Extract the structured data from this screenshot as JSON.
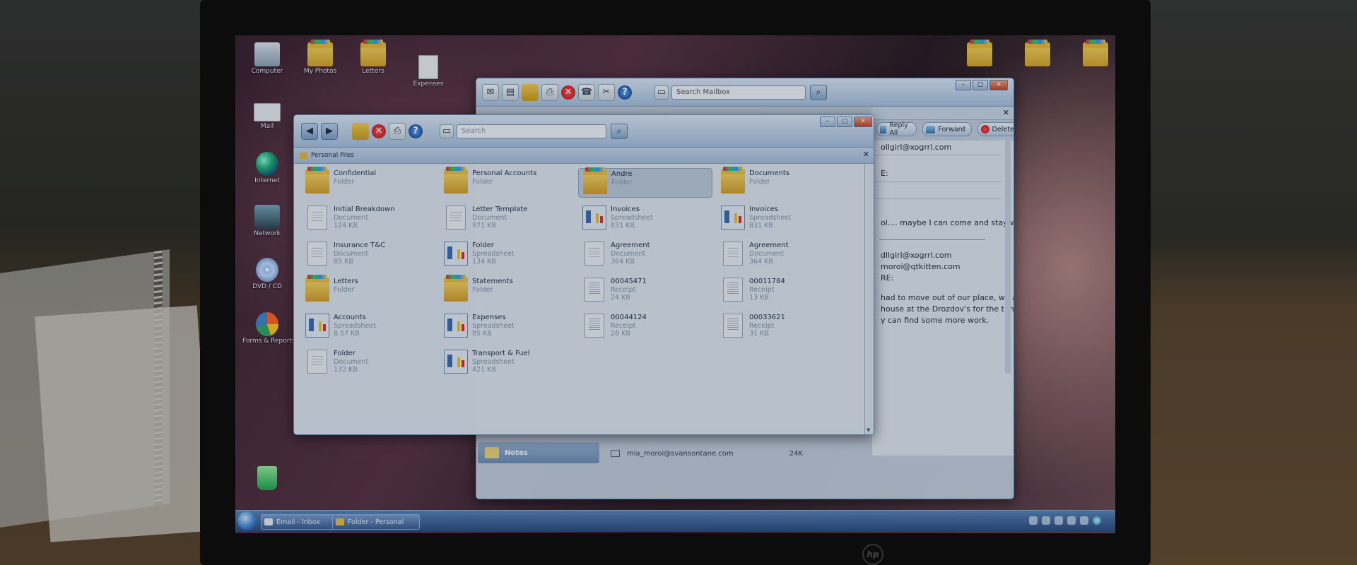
{
  "desktop": {
    "icons": [
      {
        "label": "Computer",
        "icon": "computer-icon"
      },
      {
        "label": "My Photos",
        "icon": "folder-icon"
      },
      {
        "label": "Letters",
        "icon": "folder-icon"
      },
      {
        "label": "Expenses",
        "icon": "document-icon"
      },
      {
        "label": "Mail",
        "icon": "mail-icon"
      },
      {
        "label": "Internet",
        "icon": "globe-icon"
      },
      {
        "label": "Network",
        "icon": "network-icon"
      },
      {
        "label": "DVD / CD",
        "icon": "disc-icon"
      },
      {
        "label": "Forms & Reports",
        "icon": "chart-icon"
      }
    ]
  },
  "mail_window": {
    "search_placeholder": "Search Mailbox",
    "buttons": {
      "reply_all": "Reply All",
      "forward": "Forward",
      "delete": "Delete"
    },
    "lines": [
      "ollgirl@xogrrl.com",
      "E:",
      "ol.... maybe I can come and stay with you",
      "dllgirl@xogrrl.com",
      "moroi@qtkitten.com",
      "RE:",
      "had to move out of our place, we are staying in",
      "house at the Drozdov's for the time being, until",
      "y can find some more work."
    ],
    "sidebar_notes": "Notes",
    "list_row": {
      "sender": "mia_moroi@svansontane.com",
      "size": "24K"
    }
  },
  "explorer": {
    "search_placeholder": "Search",
    "title": "Personal Files",
    "items": [
      {
        "name": "Confidential",
        "type": "Folder",
        "size": "",
        "icon": "folder"
      },
      {
        "name": "Personal Accounts",
        "type": "Folder",
        "size": "",
        "icon": "folder"
      },
      {
        "name": "Andre",
        "type": "Folder",
        "size": "",
        "icon": "folder",
        "selected": true
      },
      {
        "name": "Documents",
        "type": "Folder",
        "size": "",
        "icon": "folder"
      },
      {
        "name": "Initial Breakdown",
        "type": "Document",
        "size": "124 KB",
        "icon": "document"
      },
      {
        "name": "Letter Template",
        "type": "Document",
        "size": "971 KB",
        "icon": "document"
      },
      {
        "name": "Invoices",
        "type": "Spreadsheet",
        "size": "831 KB",
        "icon": "spreadsheet"
      },
      {
        "name": "Invoices",
        "type": "Spreadsheet",
        "size": "831 KB",
        "icon": "spreadsheet"
      },
      {
        "name": "Insurance T&C",
        "type": "Document",
        "size": "85 KB",
        "icon": "document"
      },
      {
        "name": "Folder",
        "type": "Spreadsheet",
        "size": "134 KB",
        "icon": "spreadsheet"
      },
      {
        "name": "Agreement",
        "type": "Document",
        "size": "364 KB",
        "icon": "document"
      },
      {
        "name": "Agreement",
        "type": "Document",
        "size": "364 KB",
        "icon": "document"
      },
      {
        "name": "Letters",
        "type": "Folder",
        "size": "",
        "icon": "folder"
      },
      {
        "name": "Statements",
        "type": "Folder",
        "size": "",
        "icon": "folder"
      },
      {
        "name": "00045471",
        "type": "Receipt",
        "size": "24 KB",
        "icon": "receipt"
      },
      {
        "name": "00011784",
        "type": "Receipt",
        "size": "13 KB",
        "icon": "receipt"
      },
      {
        "name": "Accounts",
        "type": "Spreadsheet",
        "size": "8.57 KB",
        "icon": "spreadsheet"
      },
      {
        "name": "Expenses",
        "type": "Spreadsheet",
        "size": "85 KB",
        "icon": "spreadsheet"
      },
      {
        "name": "00044124",
        "type": "Receipt",
        "size": "26 KB",
        "icon": "receipt"
      },
      {
        "name": "00033621",
        "type": "Receipt",
        "size": "31 KB",
        "icon": "receipt"
      },
      {
        "name": "Folder",
        "type": "Document",
        "size": "132 KB",
        "icon": "document"
      },
      {
        "name": "Transport & Fuel",
        "type": "Spreadsheet",
        "size": "421 KB",
        "icon": "spreadsheet"
      }
    ]
  },
  "taskbar": {
    "tasks": [
      "Email - Inbox",
      "Folder - Personal"
    ]
  },
  "bezel": {
    "brand": "hp"
  }
}
